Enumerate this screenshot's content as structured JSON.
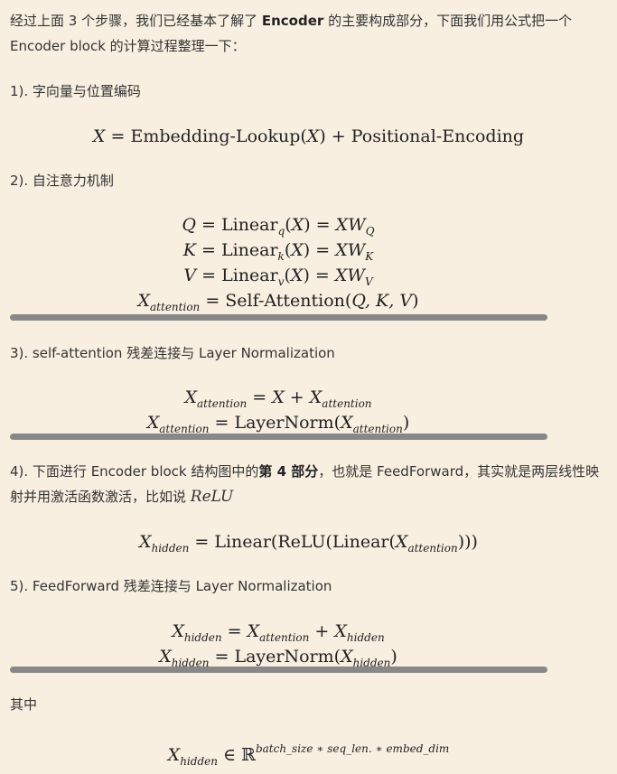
{
  "intro": {
    "part1": "经过上面 3 个步骤，我们已经基本了解了 ",
    "bold": "Encoder",
    "part2": " 的主要构成部分，下面我们用公式把一个 Encoder block 的计算过程整理一下："
  },
  "sections": [
    {
      "heading": "1). 字向量与位置编码"
    },
    {
      "heading": "2). 自注意力机制"
    },
    {
      "heading": "3). self-attention 残差连接与 Layer Normalization"
    },
    {
      "heading_part1": "4). 下面进行 Encoder block 结构图中的",
      "heading_bold": "第 4 部分",
      "heading_part2": "，也就是 FeedForward，其实就是两层线性映射并用激活函数激活，比如说 ",
      "heading_math": "ReLU"
    },
    {
      "heading": "5). FeedForward 残差连接与 Layer Normalization"
    },
    {
      "heading": "其中"
    }
  ],
  "equations": {
    "eq1": {
      "lhs": "X",
      "rhs_a": "Embedding-Lookup(",
      "arg": "X",
      "rhs_b": ") + Positional-Encoding"
    },
    "eq2": {
      "q_var": "Q",
      "q_fn": "Linear",
      "q_sub": "q",
      "q_w": "XW",
      "q_wsub": "Q",
      "k_var": "K",
      "k_fn": "Linear",
      "k_sub": "k",
      "k_w": "XW",
      "k_wsub": "K",
      "v_var": "V",
      "v_fn": "Linear",
      "v_sub": "v",
      "v_w": "XW",
      "v_wsub": "V",
      "att_var": "X",
      "att_sub": "attention",
      "att_fn": "Self-Attention(",
      "att_args": "Q, K, V",
      "att_close": ")"
    },
    "eq3": {
      "l1_var": "X",
      "l1_sub": "attention",
      "l1_x": "X",
      "l1_rvar": "X",
      "l1_rsub": "attention",
      "l2_var": "X",
      "l2_sub": "attention",
      "l2_fn": "LayerNorm(",
      "l2_rvar": "X",
      "l2_rsub": "attention",
      "l2_close": ")"
    },
    "eq4": {
      "var": "X",
      "sub": "hidden",
      "fn1": "Linear(ReLU(Linear(",
      "rvar": "X",
      "rsub": "attention",
      "close": ")))"
    },
    "eq5": {
      "l1_var": "X",
      "l1_sub": "hidden",
      "l1_rvar1": "X",
      "l1_rsub1": "attention",
      "l1_rvar2": "X",
      "l1_rsub2": "hidden",
      "l2_var": "X",
      "l2_sub": "hidden",
      "l2_fn": "LayerNorm(",
      "l2_rvar": "X",
      "l2_rsub": "hidden",
      "l2_close": ")"
    },
    "eq6": {
      "var": "X",
      "sub": "hidden",
      "in": "∈",
      "set": "ℝ",
      "sup": "batch_size ∗ seq_len. ∗ embed_dim"
    }
  }
}
